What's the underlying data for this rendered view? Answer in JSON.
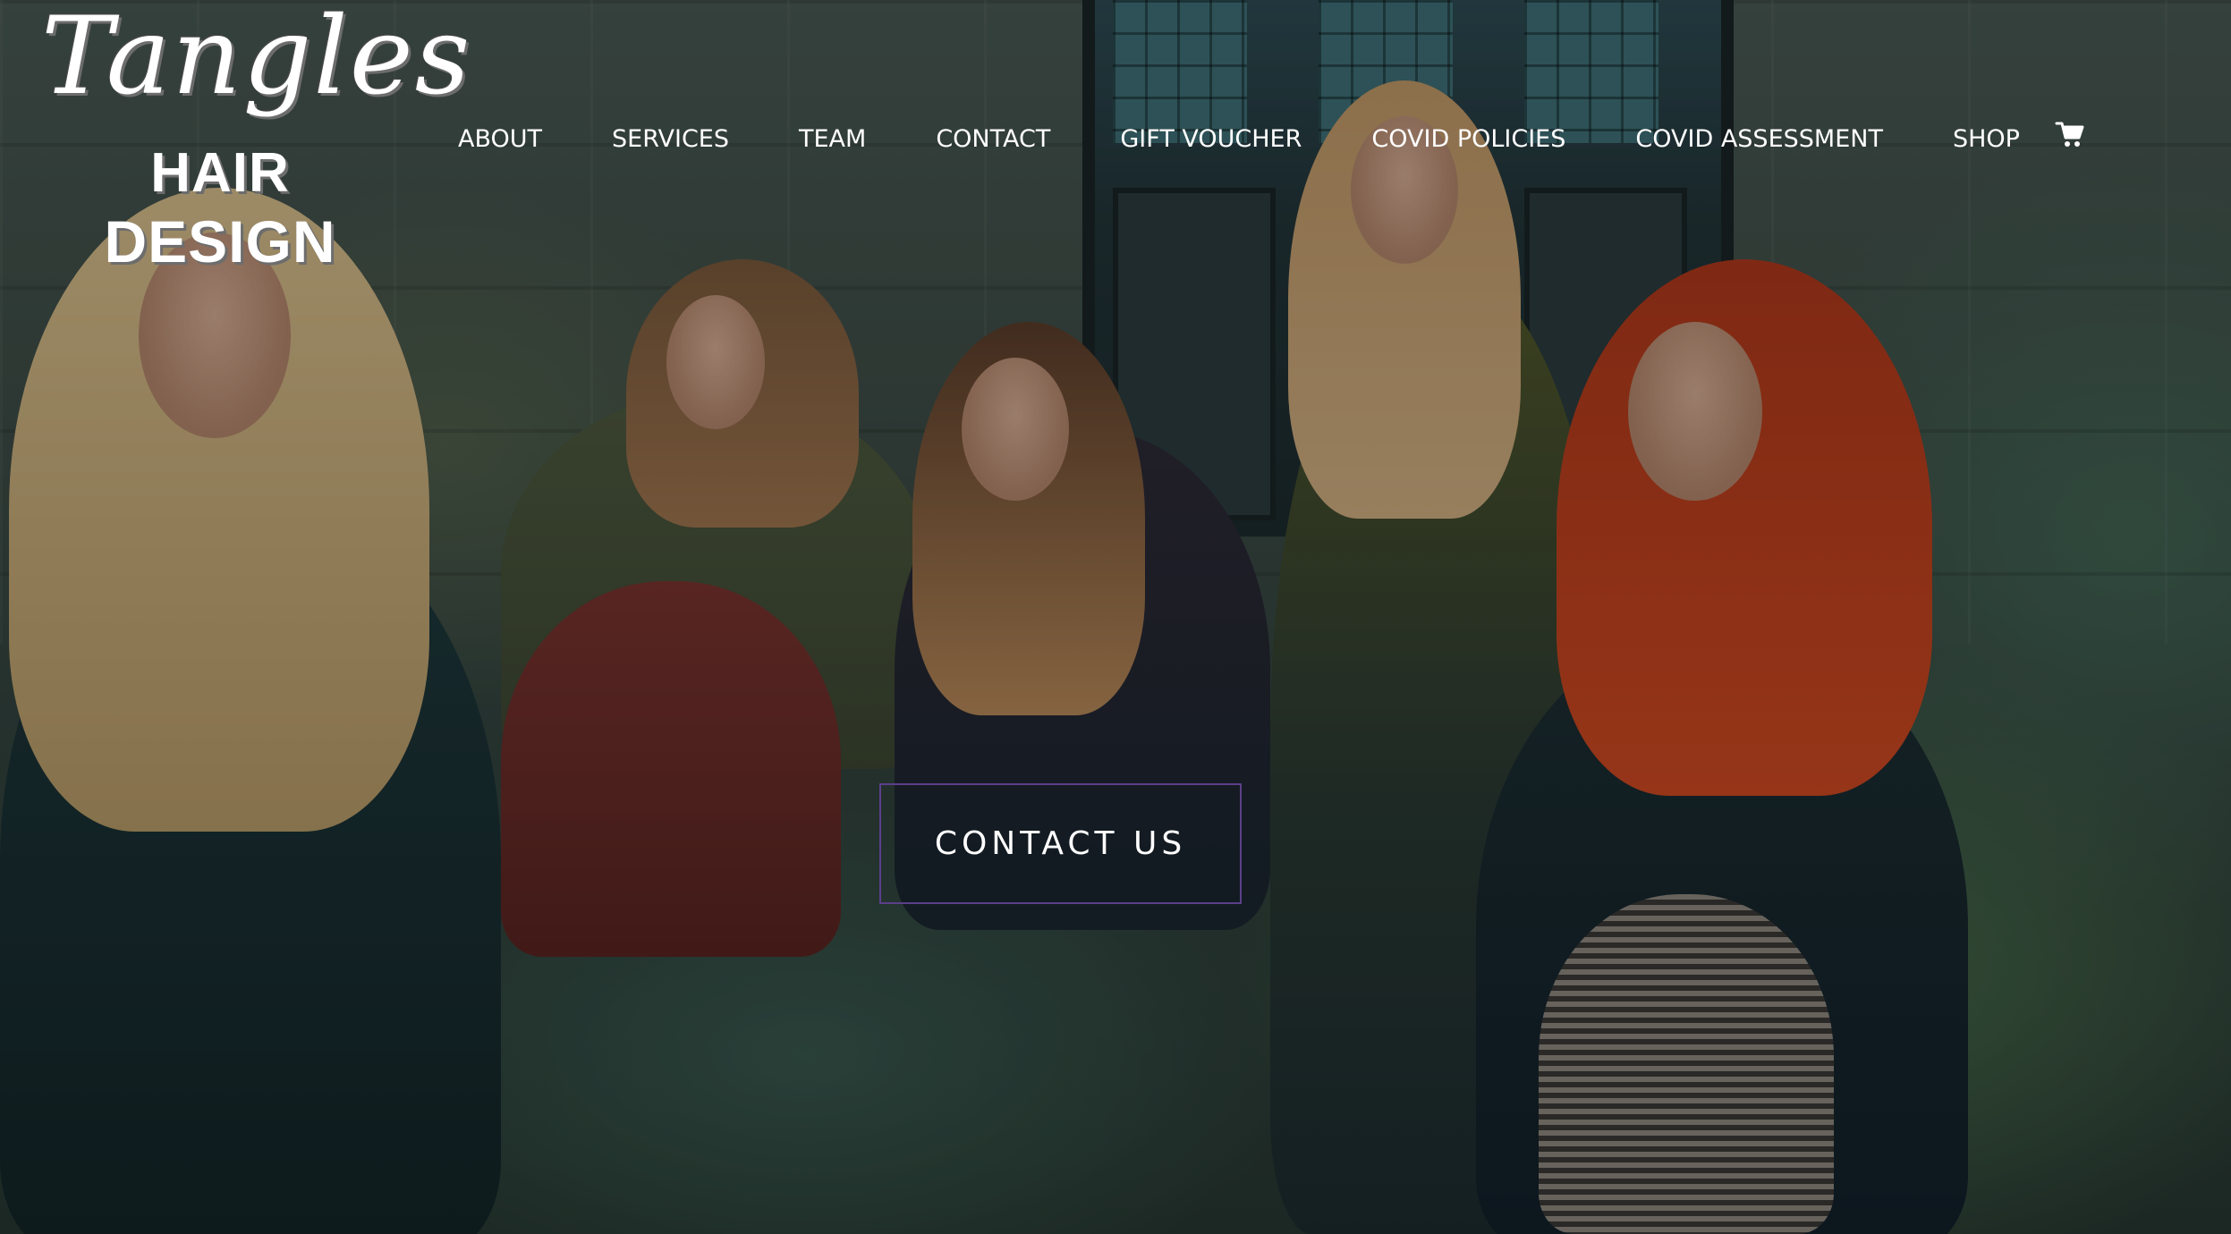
{
  "logo": {
    "script_text": "Tangles",
    "line1": "HAIR",
    "line2": "DESIGN"
  },
  "nav": {
    "items": [
      {
        "label": "ABOUT"
      },
      {
        "label": "SERVICES"
      },
      {
        "label": "TEAM"
      },
      {
        "label": "CONTACT"
      },
      {
        "label": "GIFT VOUCHER"
      },
      {
        "label": "COVID POLICIES"
      },
      {
        "label": "COVID ASSESSMENT"
      },
      {
        "label": "SHOP"
      }
    ],
    "cart_icon": "shopping-cart-icon"
  },
  "hero": {
    "cta_label": "CONTACT US",
    "cta_border_color": "#5b3f8a"
  },
  "colors": {
    "nav_text": "#ffffff",
    "overlay": "rgba(0,0,0,0.28)"
  }
}
